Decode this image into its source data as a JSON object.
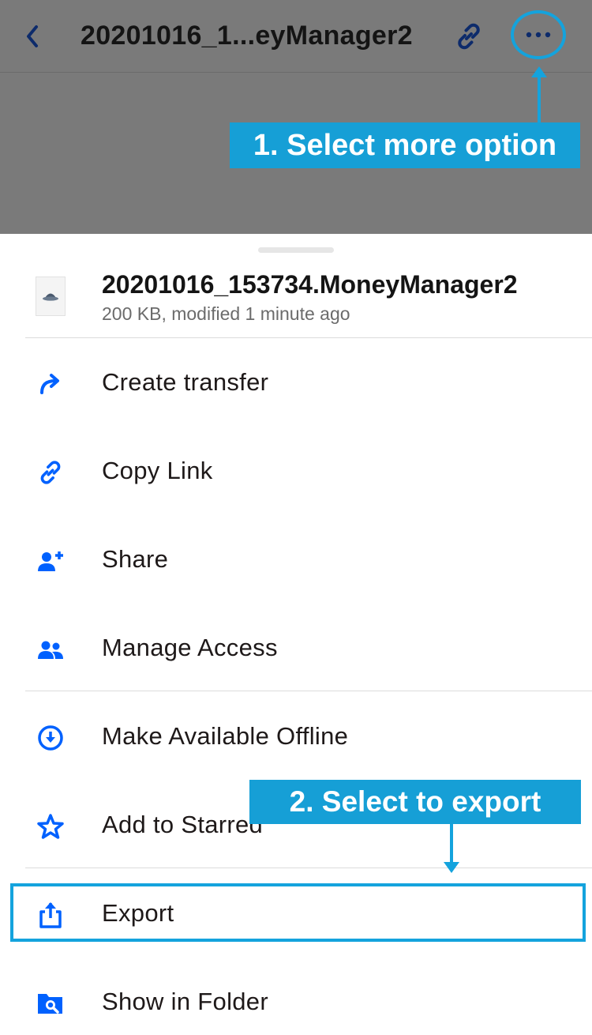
{
  "header": {
    "title": "20201016_1...eyManager2",
    "back_icon": "chevron-left-icon",
    "link_icon": "link-icon",
    "more_icon": "more-horizontal-icon"
  },
  "annotations": {
    "step1": "1. Select more option",
    "step2": "2. Select to export",
    "highlight_color": "#14a3dd"
  },
  "file": {
    "name": "20201016_153734.MoneyManager2",
    "meta": "200 KB, modified 1 minute ago",
    "icon": "file-icon"
  },
  "menu": {
    "items": [
      {
        "label": "Create transfer",
        "icon": "share-arrow-icon"
      },
      {
        "label": "Copy Link",
        "icon": "link-icon"
      },
      {
        "label": "Share",
        "icon": "person-add-icon"
      },
      {
        "label": "Manage Access",
        "icon": "people-icon"
      },
      {
        "label": "Make Available Offline",
        "icon": "download-circle-icon"
      },
      {
        "label": "Add to Starred",
        "icon": "star-icon"
      },
      {
        "label": "Export",
        "icon": "export-icon"
      },
      {
        "label": "Show in Folder",
        "icon": "folder-search-icon"
      }
    ]
  },
  "colors": {
    "accent": "#0061fe",
    "overlay": "#7a7a7a"
  }
}
